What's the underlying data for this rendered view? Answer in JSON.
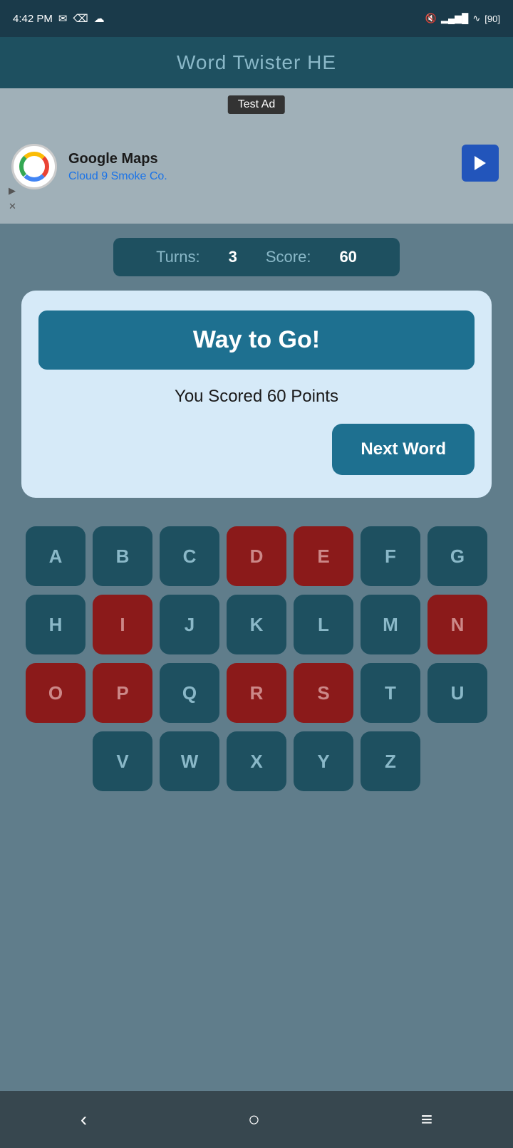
{
  "statusBar": {
    "time": "4:42 PM",
    "battery": "90"
  },
  "titleBar": {
    "title": "Word Twister HE"
  },
  "ad": {
    "label": "Test Ad",
    "company": "Google Maps",
    "subtitle": "Cloud 9 Smoke Co."
  },
  "scoreBar": {
    "turnsLabel": "Turns:",
    "turnsValue": "3",
    "scoreLabel": "Score:",
    "scoreValue": "60"
  },
  "modal": {
    "headerText": "Way to Go!",
    "bodyText": "You Scored 60 Points",
    "nextWordLabel": "Next Word"
  },
  "keyboard": {
    "rows": [
      [
        {
          "letter": "A",
          "used": false
        },
        {
          "letter": "B",
          "used": false
        },
        {
          "letter": "C",
          "used": false
        },
        {
          "letter": "D",
          "used": true
        },
        {
          "letter": "E",
          "used": true
        },
        {
          "letter": "F",
          "used": false
        },
        {
          "letter": "G",
          "used": false
        }
      ],
      [
        {
          "letter": "H",
          "used": false
        },
        {
          "letter": "I",
          "used": true
        },
        {
          "letter": "J",
          "used": false
        },
        {
          "letter": "K",
          "used": false
        },
        {
          "letter": "L",
          "used": false
        },
        {
          "letter": "M",
          "used": false
        },
        {
          "letter": "N",
          "used": true
        }
      ],
      [
        {
          "letter": "O",
          "used": true
        },
        {
          "letter": "P",
          "used": true
        },
        {
          "letter": "Q",
          "used": false
        },
        {
          "letter": "R",
          "used": true
        },
        {
          "letter": "S",
          "used": true
        },
        {
          "letter": "T",
          "used": false
        },
        {
          "letter": "U",
          "used": false
        }
      ],
      [
        {
          "letter": "V",
          "used": false
        },
        {
          "letter": "W",
          "used": false
        },
        {
          "letter": "X",
          "used": false
        },
        {
          "letter": "Y",
          "used": false
        },
        {
          "letter": "Z",
          "used": false
        }
      ]
    ]
  }
}
